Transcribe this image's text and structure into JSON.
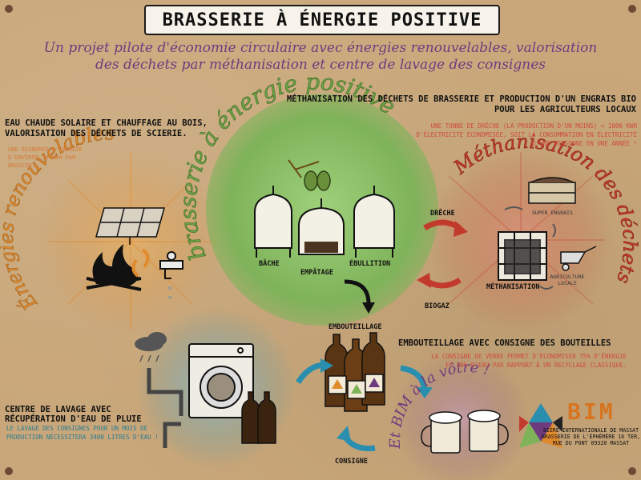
{
  "title": "BRASSERIE À ÉNERGIE POSITIVE",
  "subtitle": "Un projet pilote d'économie circulaire avec énergies renouvelables, valorisation des déchets par méthanisation et centre de lavage des consignes",
  "renewables": {
    "heading": "EAU CHAUDE SOLAIRE ET CHAUFFAGE AU BOIS, VALORISATION DES DÉCHETS DE SCIERIE.",
    "note": "UNE ÉCONOMIE D'ÉNERGIE D'ENVIRON 70 KWH PAR BRASSIN.",
    "circle_title": "Énergies renouvelables"
  },
  "methanisation": {
    "heading": "MÉTHANISATION DES DÉCHETS DE BRASSERIE ET PRODUCTION D'UN ENGRAIS BIO POUR LES AGRICULTEURS LOCAUX",
    "note": "UNE TONNE DE DRÊCHE (LA PRODUCTION D'UN MOINS) = 1000 KWH D'ÉLECTRICITÉ ÉCONOMISÉE, SOIT LA CONSOMMATION EN ÉLECTRICITÉ D'UNE PERSONNE EN UNE ANNÉE !",
    "circle_title": "Méthanisation des déchets",
    "labels": {
      "super_engrais": "SUPER ENGRAIS",
      "methanisation": "MÉTHANISATION",
      "agriculture": "AGRICULTURE LOCALE"
    }
  },
  "brewery": {
    "circle_title": "brasserie à énergie positive",
    "labels": {
      "bache": "BÂCHE",
      "empatage": "EMPÂTAGE",
      "ebullition": "ÉBULLITION"
    }
  },
  "flow": {
    "dreche": "DRÊCHE",
    "biogaz": "BIOGAZ",
    "embouteillage": "EMBOUTEILLAGE",
    "consigne": "CONSIGNE"
  },
  "bottling": {
    "heading": "EMBOUTEILLAGE AVEC CONSIGNE DES BOUTEILLES",
    "note": "LA CONSIGNE DE VERRE PERMET D'ÉCONOMISER 75% D'ÉNERGIE ET 50% D'EAU PAR RAPPORT À UN RECYCLAGE CLASSIQUE."
  },
  "washing": {
    "heading": "CENTRE DE LAVAGE AVEC RÉCUPÉRATION D'EAU DE PLUIE",
    "note": "LE LAVAGE DES CONSIGNES POUR UN MOIS DE PRODUCTION NÉCESSITERA 3400 LITRES D'EAU !"
  },
  "toast": "Et BIM à la vôtre !",
  "brand": {
    "logo": "BIM",
    "address": "BIÈRE INTERNATIONALE DE MASSAT BRASSERIE DE L'ÉPHÉMÈRE 16 TER, RUE DU PONT 09320 MASSAT"
  },
  "colors": {
    "background": "#c9a77a",
    "green": "#7fb35a",
    "orange": "#e08a2e",
    "red": "#c23a2c",
    "purple": "#6f3b7f",
    "teal": "#2a8fae"
  }
}
